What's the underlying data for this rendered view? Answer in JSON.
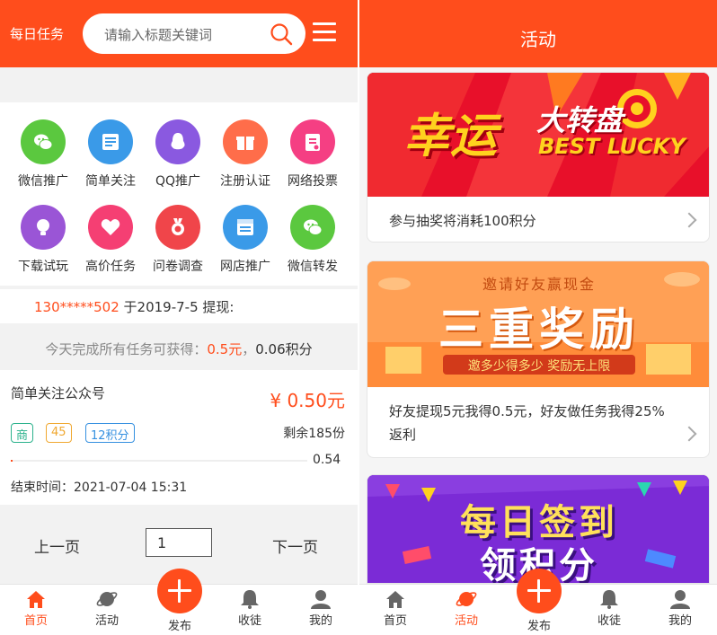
{
  "left": {
    "header": {
      "brand": "每日任务",
      "search_placeholder": "请输入标题关键词"
    },
    "grid": [
      {
        "label": "微信推广",
        "icon": "wechat-icon",
        "color": "#5bc83f"
      },
      {
        "label": "简单关注",
        "icon": "document-icon",
        "color": "#3a9ae8"
      },
      {
        "label": "QQ推广",
        "icon": "qq-penguin-icon",
        "color": "#8a59e0"
      },
      {
        "label": "注册认证",
        "icon": "gift-icon",
        "color": "#ff6d4a"
      },
      {
        "label": "网络投票",
        "icon": "clipboard-icon",
        "color": "#f53f83"
      },
      {
        "label": "下载试玩",
        "icon": "lightbulb-icon",
        "color": "#9a55d6"
      },
      {
        "label": "高价任务",
        "icon": "heart-icon",
        "color": "#f53f73"
      },
      {
        "label": "问卷调查",
        "icon": "medal-icon",
        "color": "#f0454a"
      },
      {
        "label": "网店推广",
        "icon": "shop-page-icon",
        "color": "#3a9ae8"
      },
      {
        "label": "微信转发",
        "icon": "wechat-icon",
        "color": "#5bc83f"
      }
    ],
    "notice": {
      "phone": "130*****502",
      "rest": " 于2019-7-5 提现:"
    },
    "summary": {
      "prefix": "今天完成所有任务可获得：",
      "money": "0.5元",
      "sep": "，",
      "points": "0.06积分"
    },
    "task": {
      "title": "简单关注公众号",
      "price": "¥ 0.50元",
      "tag_shop": "商",
      "tag_num": "45",
      "tag_points": "12积分",
      "remaining": "剩余185份",
      "progress_fraction": 0.0054,
      "progress_text": "0.54",
      "end_time": "结束时间：2021-07-04 15:31"
    },
    "pager": {
      "prev": "上一页",
      "page": "1",
      "next": "下一页"
    }
  },
  "nav": {
    "home": "首页",
    "activity": "活动",
    "publish": "发布",
    "favorites": "收徒",
    "mine": "我的"
  },
  "right": {
    "title": "活动",
    "cards": [
      {
        "banner_title": "幸运",
        "banner_title2": "大转盘",
        "banner_sub": "BEST LUCKY",
        "text": "参与抽奖将消耗100积分"
      },
      {
        "banner_top": "邀请好友赢现金",
        "banner_title": "三重奖励",
        "banner_sub": "邀多少得多少 奖励无上限",
        "text": "好友提现5元我得0.5元，好友做任务我得25%返利"
      },
      {
        "banner_title": "每日签到",
        "banner_title2": "领积分"
      }
    ]
  },
  "colors": {
    "brand": "#ff4d1c",
    "bg": "#f2f2f2"
  }
}
